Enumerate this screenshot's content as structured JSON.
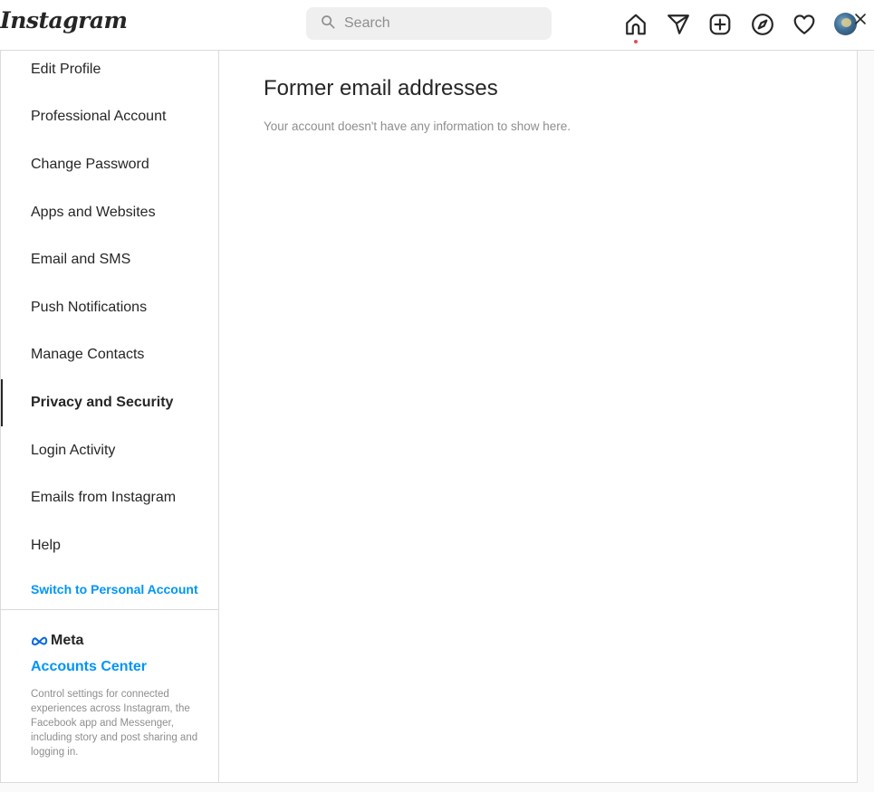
{
  "header": {
    "logo_text": "Instagram",
    "search_placeholder": "Search",
    "icons": [
      "home-icon",
      "direct-message-icon",
      "new-post-icon",
      "explore-icon",
      "activity-heart-icon",
      "profile-avatar",
      "close-icon"
    ],
    "notification_dot_color": "#ed4956"
  },
  "sidebar": {
    "items": [
      {
        "label": "Edit Profile",
        "active": false
      },
      {
        "label": "Professional Account",
        "active": false
      },
      {
        "label": "Change Password",
        "active": false
      },
      {
        "label": "Apps and Websites",
        "active": false
      },
      {
        "label": "Email and SMS",
        "active": false
      },
      {
        "label": "Push Notifications",
        "active": false
      },
      {
        "label": "Manage Contacts",
        "active": false
      },
      {
        "label": "Privacy and Security",
        "active": true
      },
      {
        "label": "Login Activity",
        "active": false
      },
      {
        "label": "Emails from Instagram",
        "active": false
      },
      {
        "label": "Help",
        "active": false
      }
    ],
    "switch_account_label": "Switch to Personal Account",
    "meta": {
      "logo_text": "Meta",
      "accounts_center_label": "Accounts Center",
      "description": "Control settings for connected experiences across Instagram, the Facebook app and Messenger, including story and post sharing and logging in."
    }
  },
  "main": {
    "title": "Former email addresses",
    "empty_message": "Your account doesn't have any information to show here."
  },
  "colors": {
    "link_blue": "#0095f6",
    "text_primary": "#262626",
    "text_secondary": "#8e8e8e",
    "border": "#dbdbdb"
  }
}
